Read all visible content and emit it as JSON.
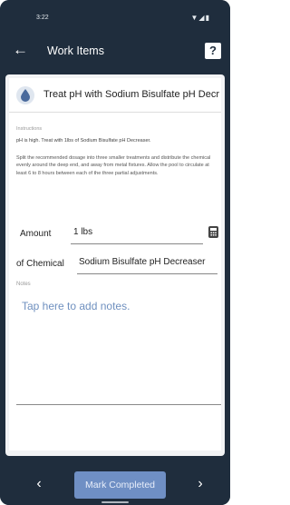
{
  "status_bar": {
    "time": "3:22",
    "icons": "▼◢▮"
  },
  "app_bar": {
    "back_glyph": "←",
    "title": "Work Items",
    "help_glyph": "?"
  },
  "task": {
    "title": "Treat pH with Sodium Bisulfate pH Decre...",
    "icon": "water-drop-icon"
  },
  "instructions": {
    "label": "Instructions",
    "line1": "pH is high. Treat with 1lbs of Sodium Bisulfate pH Decreaser.",
    "paragraph": "Split the recommended dosage into three smaller treatments and distribute the chemical evenly around the deep end, and away from metal fixtures.  Allow the pool to circulate at least 6 to 8 hours between each of the three partial adjustments."
  },
  "form": {
    "amount_label": "Amount",
    "amount_value": "1 lbs",
    "chemical_label": "of Chemical",
    "chemical_value": "Sodium Bisulfate pH Decreaser",
    "notes_label": "Notes",
    "notes_placeholder": "Tap here to add notes."
  },
  "bottom_bar": {
    "prev_glyph": "‹",
    "complete_label": "Mark Completed",
    "next_glyph": "›"
  },
  "colors": {
    "app_bar": "#1f2d3d",
    "button": "#6f8fc4",
    "placeholder": "#6f90bf"
  }
}
